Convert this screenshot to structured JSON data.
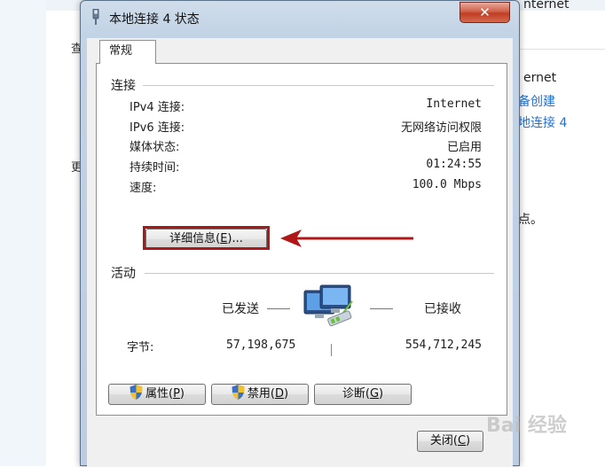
{
  "background": {
    "peek_left_1": "查",
    "peek_left_2": "更",
    "peek_right_1": "nternet",
    "peek_right_2": "ernet",
    "link_1": "备创建",
    "link_2": "地连接 4",
    "peek_right_3": "点。"
  },
  "dialog": {
    "title": "本地连接 4 状态",
    "close_glyph": "✕",
    "tab_label": "常规",
    "connection": {
      "group_label": "连接",
      "rows": [
        {
          "label": "IPv4 连接:",
          "value": "Internet"
        },
        {
          "label": "IPv6 连接:",
          "value": "无网络访问权限"
        },
        {
          "label": "媒体状态:",
          "value": "已启用"
        },
        {
          "label": "持续时间:",
          "value": "01:24:55"
        },
        {
          "label": "速度:",
          "value": "100.0 Mbps"
        }
      ],
      "details_button": {
        "text": "详细信息",
        "mnemonic": "E",
        "suffix": "..."
      }
    },
    "activity": {
      "group_label": "活动",
      "sent_label": "已发送",
      "received_label": "已接收",
      "bytes_label": "字节:",
      "bytes_sent": "57,198,675",
      "bytes_received": "554,712,245"
    },
    "buttons": {
      "properties": {
        "text": "属性",
        "mnemonic": "P"
      },
      "disable": {
        "text": "禁用",
        "mnemonic": "D"
      },
      "diagnose": {
        "text": "诊断",
        "mnemonic": "G"
      },
      "close": {
        "text": "关闭",
        "mnemonic": "C"
      }
    }
  },
  "annotation": {
    "highlight_color": "#a81a1a",
    "arrow_color": "#b01818"
  },
  "watermark": "Bai 经验"
}
